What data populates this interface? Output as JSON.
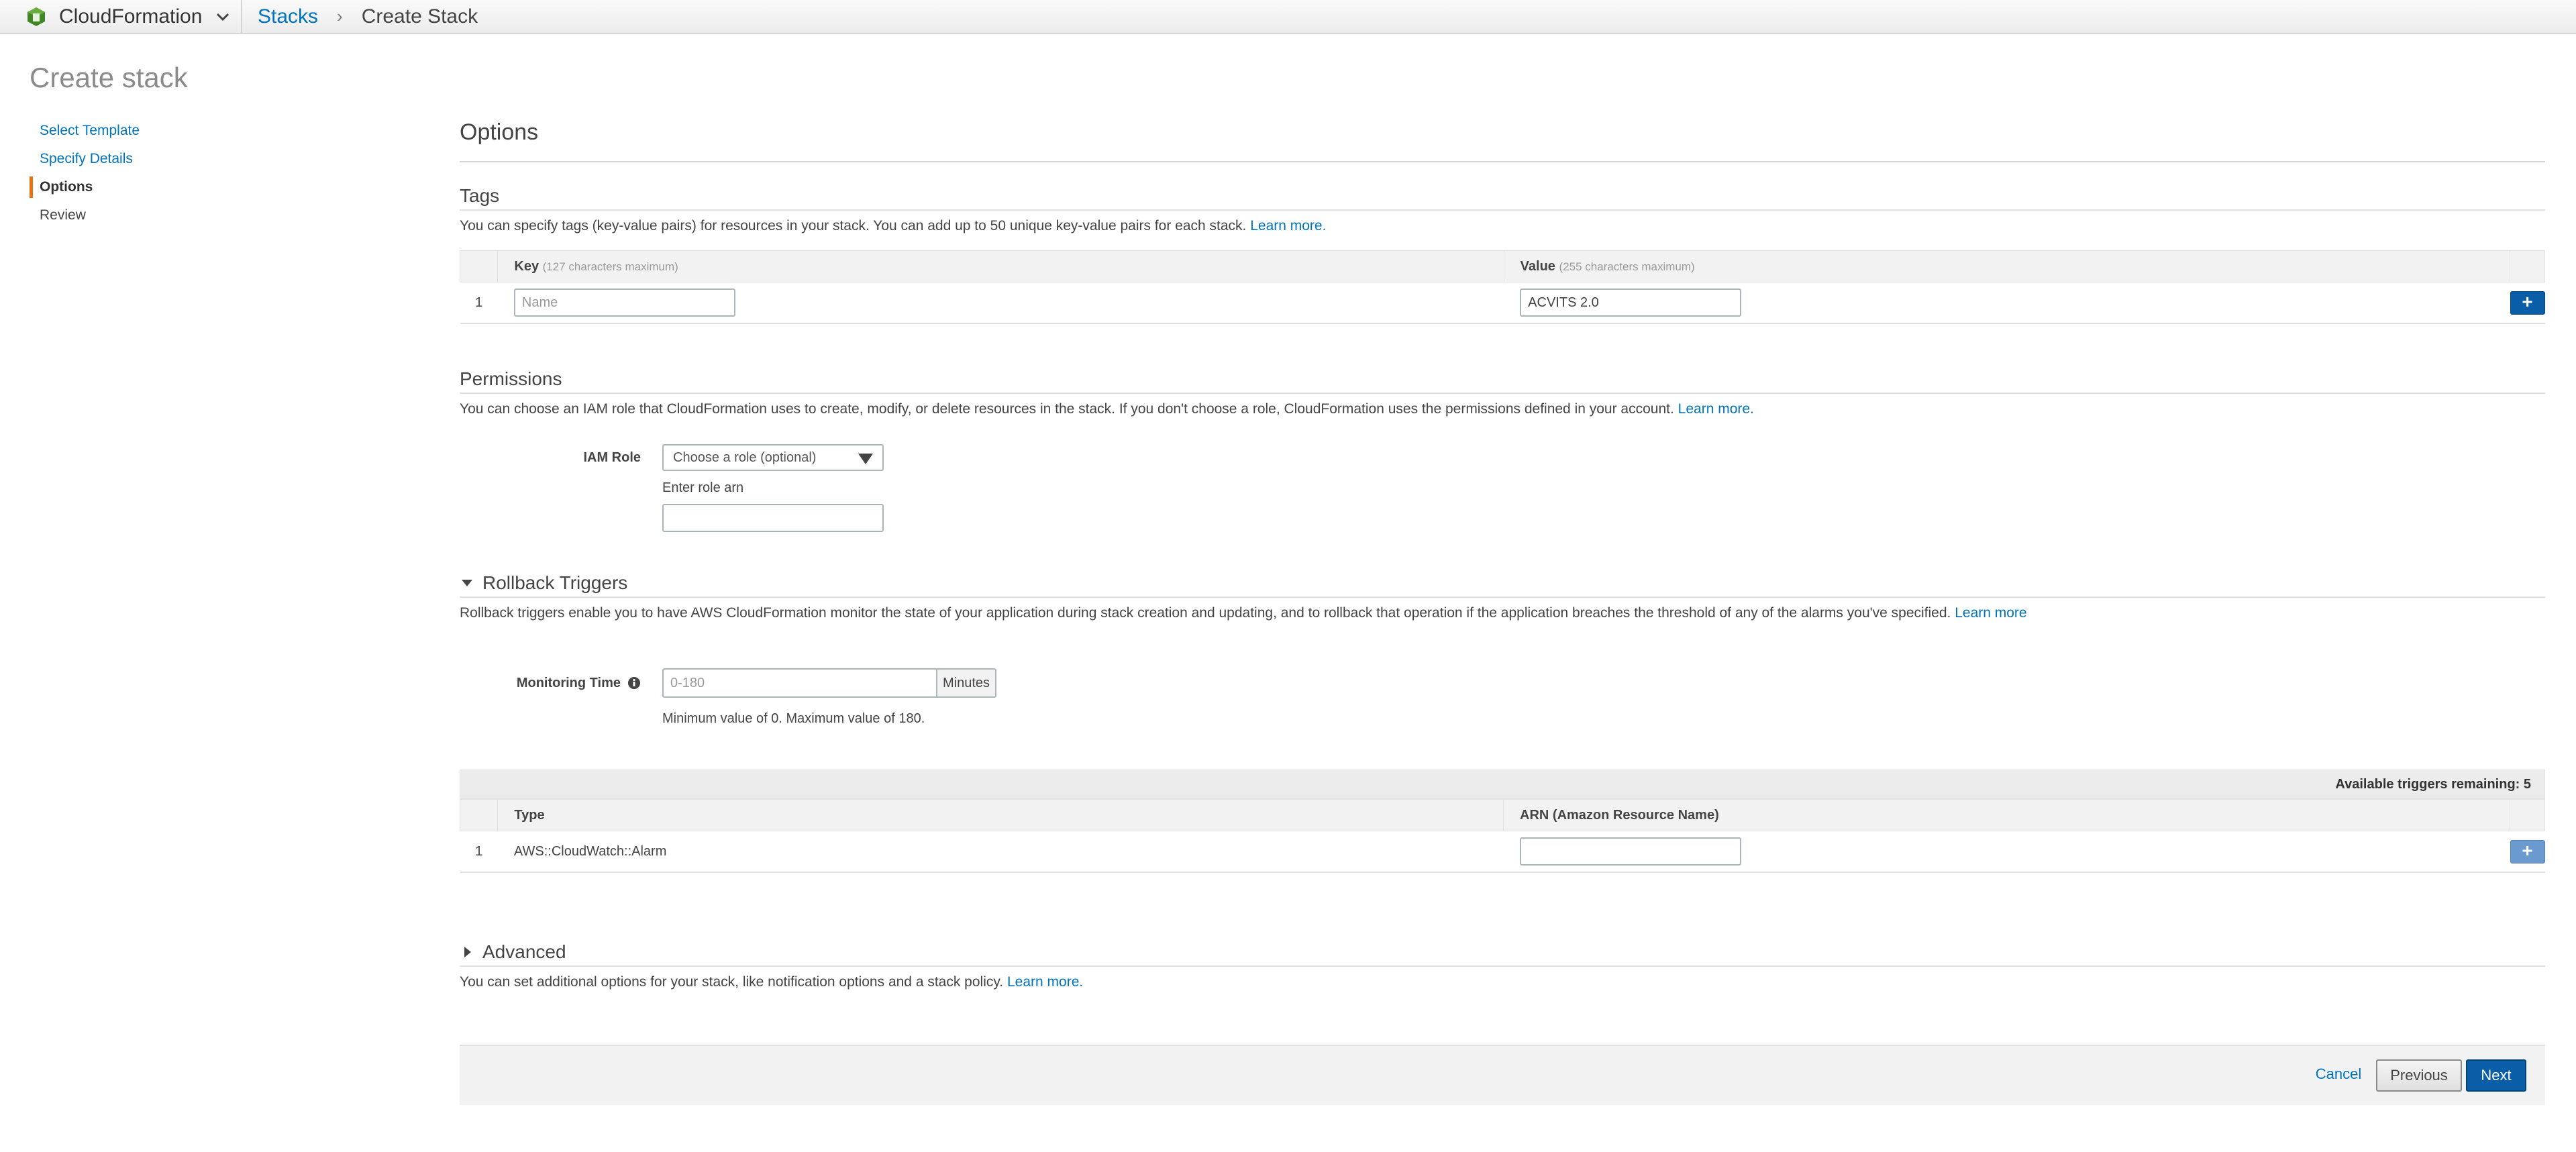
{
  "topbar": {
    "service_name": "CloudFormation",
    "breadcrumb_stacks": "Stacks",
    "breadcrumb_separator": "›",
    "breadcrumb_current": "Create Stack"
  },
  "page": {
    "title": "Create stack"
  },
  "nav": {
    "items": [
      {
        "label": "Select Template"
      },
      {
        "label": "Specify Details"
      },
      {
        "label": "Options"
      },
      {
        "label": "Review"
      }
    ]
  },
  "options": {
    "heading": "Options"
  },
  "tags": {
    "title": "Tags",
    "description": "You can specify tags (key-value pairs) for resources in your stack. You can add up to 50 unique key-value pairs for each stack.",
    "learn_more": "Learn more.",
    "col_key": "Key",
    "col_key_hint": "(127 characters maximum)",
    "col_value": "Value",
    "col_value_hint": "(255 characters maximum)",
    "rows": [
      {
        "index": "1",
        "key": "Name",
        "value": "ACVITS 2.0"
      }
    ],
    "add_label": "+"
  },
  "permissions": {
    "title": "Permissions",
    "description": "You can choose an IAM role that CloudFormation uses to create, modify, or delete resources in the stack. If you don't choose a role, CloudFormation uses the permissions defined in your account.",
    "learn_more": "Learn more.",
    "iam_label": "IAM Role",
    "select_placeholder": "Choose a role (optional)",
    "arn_label": "Enter role arn",
    "arn_value": ""
  },
  "rollback": {
    "title": "Rollback Triggers",
    "description": "Rollback triggers enable you to have AWS CloudFormation monitor the state of your application during stack creation and updating, and to rollback that operation if the application breaches the threshold of any of the alarms you've specified.",
    "learn_more": "Learn more",
    "monitoring_label": "Monitoring Time",
    "monitoring_placeholder": "0-180",
    "monitoring_unit": "Minutes",
    "monitoring_hint": "Minimum value of 0. Maximum value of 180.",
    "available": "Available triggers remaining: 5",
    "col_type": "Type",
    "col_arn": "ARN (Amazon Resource Name)",
    "rows": [
      {
        "index": "1",
        "type": "AWS::CloudWatch::Alarm",
        "arn": ""
      }
    ],
    "add_label": "+"
  },
  "advanced": {
    "title": "Advanced",
    "description": "You can set additional options for your stack, like notification options and a stack policy.",
    "learn_more": "Learn more."
  },
  "footer": {
    "cancel": "Cancel",
    "previous": "Previous",
    "next": "Next"
  },
  "colors": {
    "link": "#0073bb",
    "primary": "#0a5ea8",
    "accent": "#ec7211",
    "logo": "#3f8624"
  }
}
